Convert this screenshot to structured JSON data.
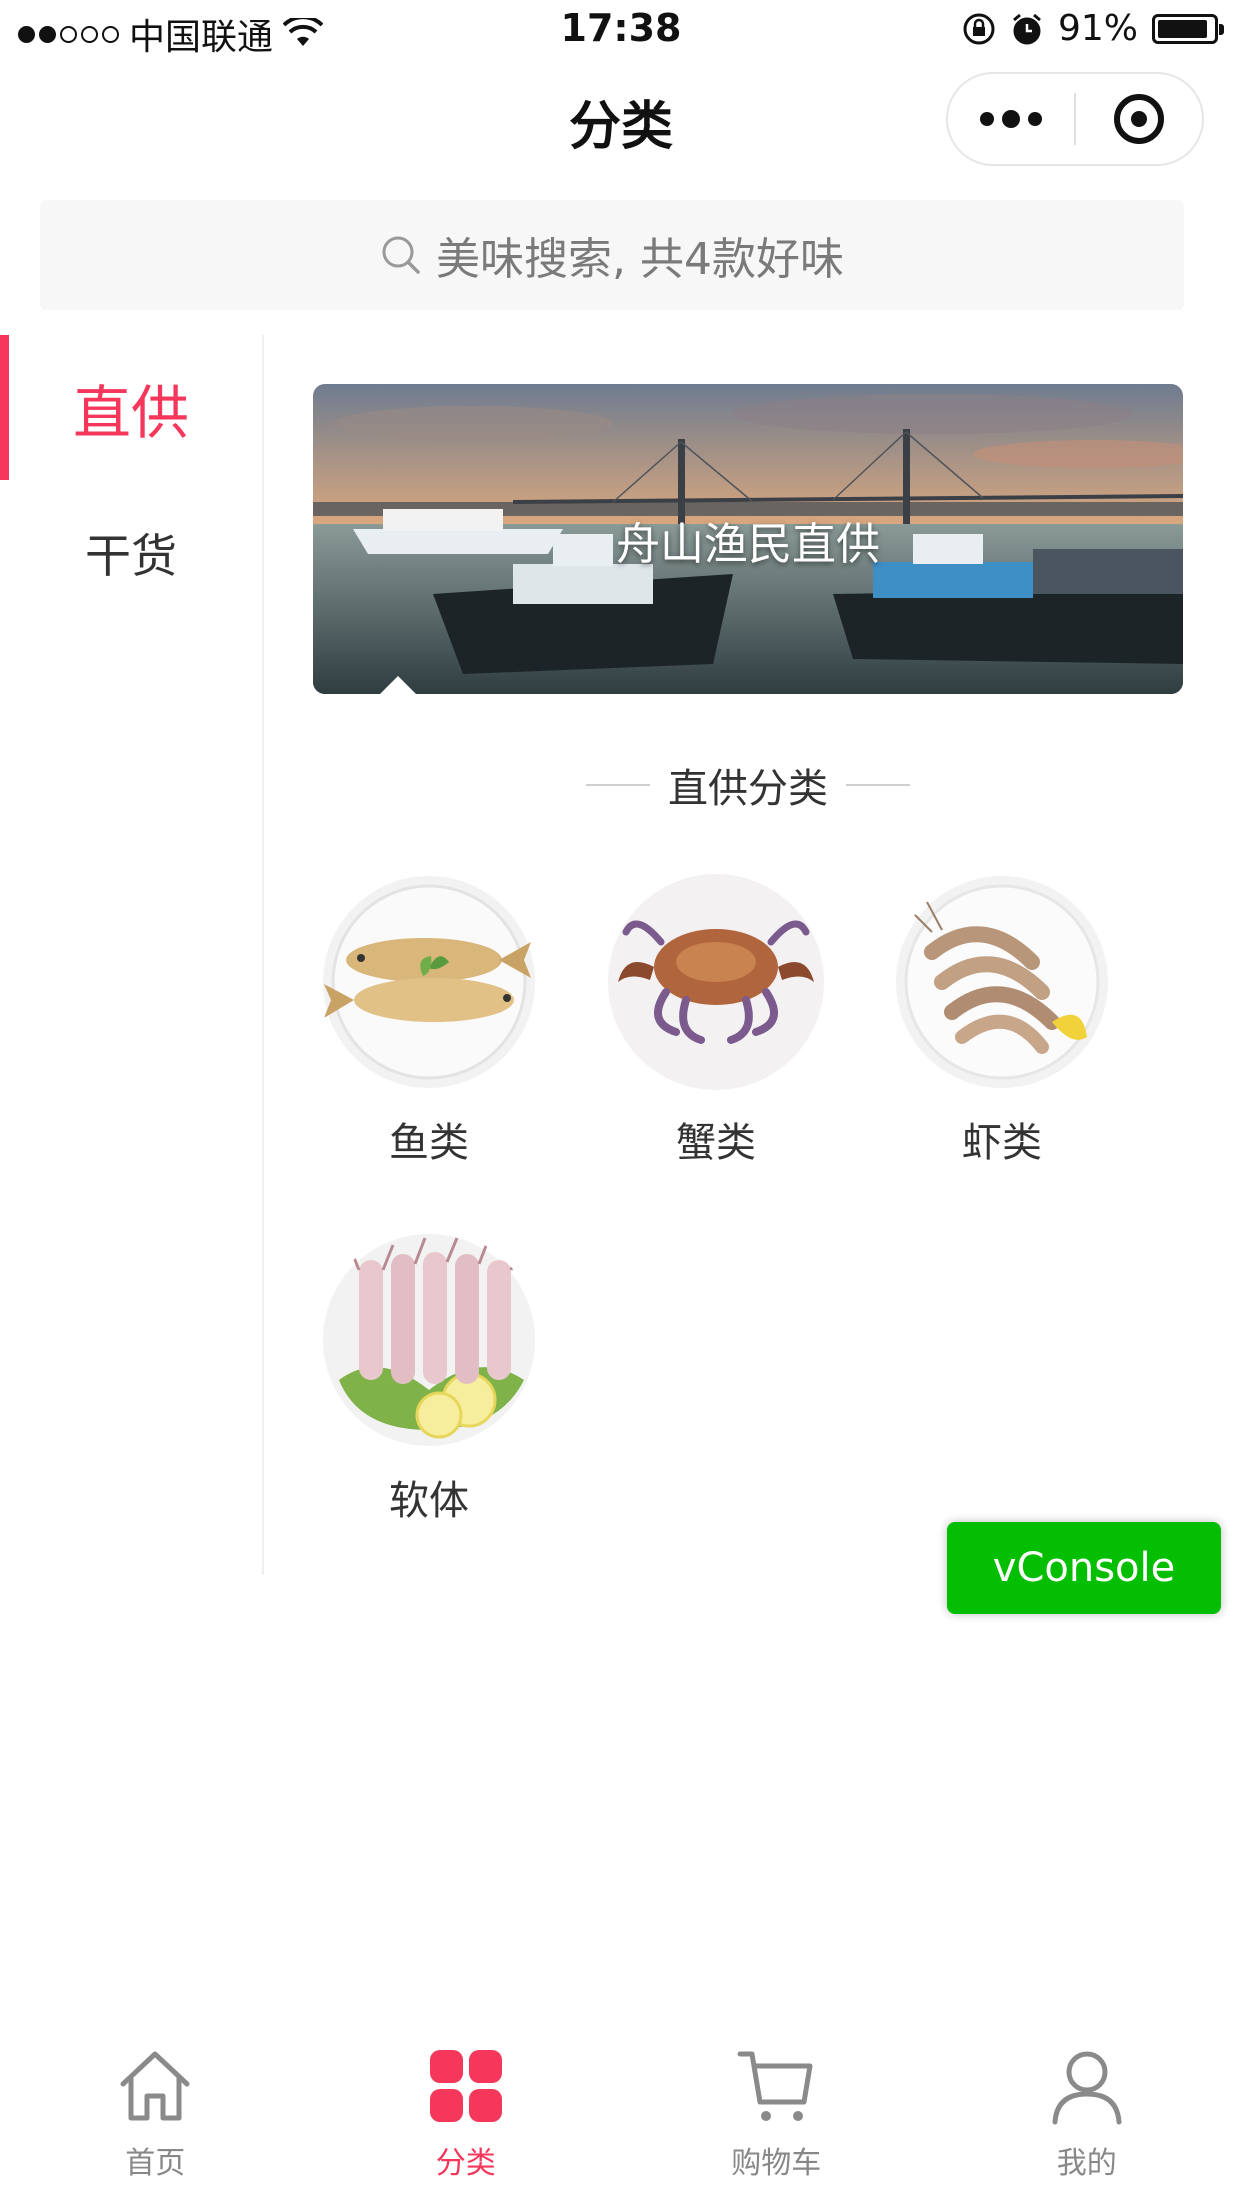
{
  "status_bar": {
    "carrier": "中国联通",
    "time": "17:38",
    "battery": "91%",
    "battery_level": 0.91
  },
  "nav": {
    "title": "分类"
  },
  "search": {
    "placeholder": "美味搜索, 共4款好味"
  },
  "sidebar": {
    "items": [
      {
        "label": "直供",
        "active": true
      },
      {
        "label": "干货",
        "active": false
      }
    ]
  },
  "banner": {
    "text": "舟山渔民直供"
  },
  "section": {
    "title": "直供分类"
  },
  "categories": [
    {
      "label": "鱼类",
      "icon": "fish-plate-image"
    },
    {
      "label": "蟹类",
      "icon": "crab-plate-image"
    },
    {
      "label": "虾类",
      "icon": "shrimp-plate-image"
    },
    {
      "label": "软体",
      "icon": "squid-plate-image"
    }
  ],
  "vconsole": {
    "label": "vConsole"
  },
  "tabbar": {
    "items": [
      {
        "label": "首页",
        "icon": "home-icon",
        "active": false
      },
      {
        "label": "分类",
        "icon": "grid-icon",
        "active": true
      },
      {
        "label": "购物车",
        "icon": "cart-icon",
        "active": false
      },
      {
        "label": "我的",
        "icon": "user-icon",
        "active": false
      }
    ]
  },
  "colors": {
    "accent": "#f5375c",
    "vconsole": "#04be02"
  }
}
